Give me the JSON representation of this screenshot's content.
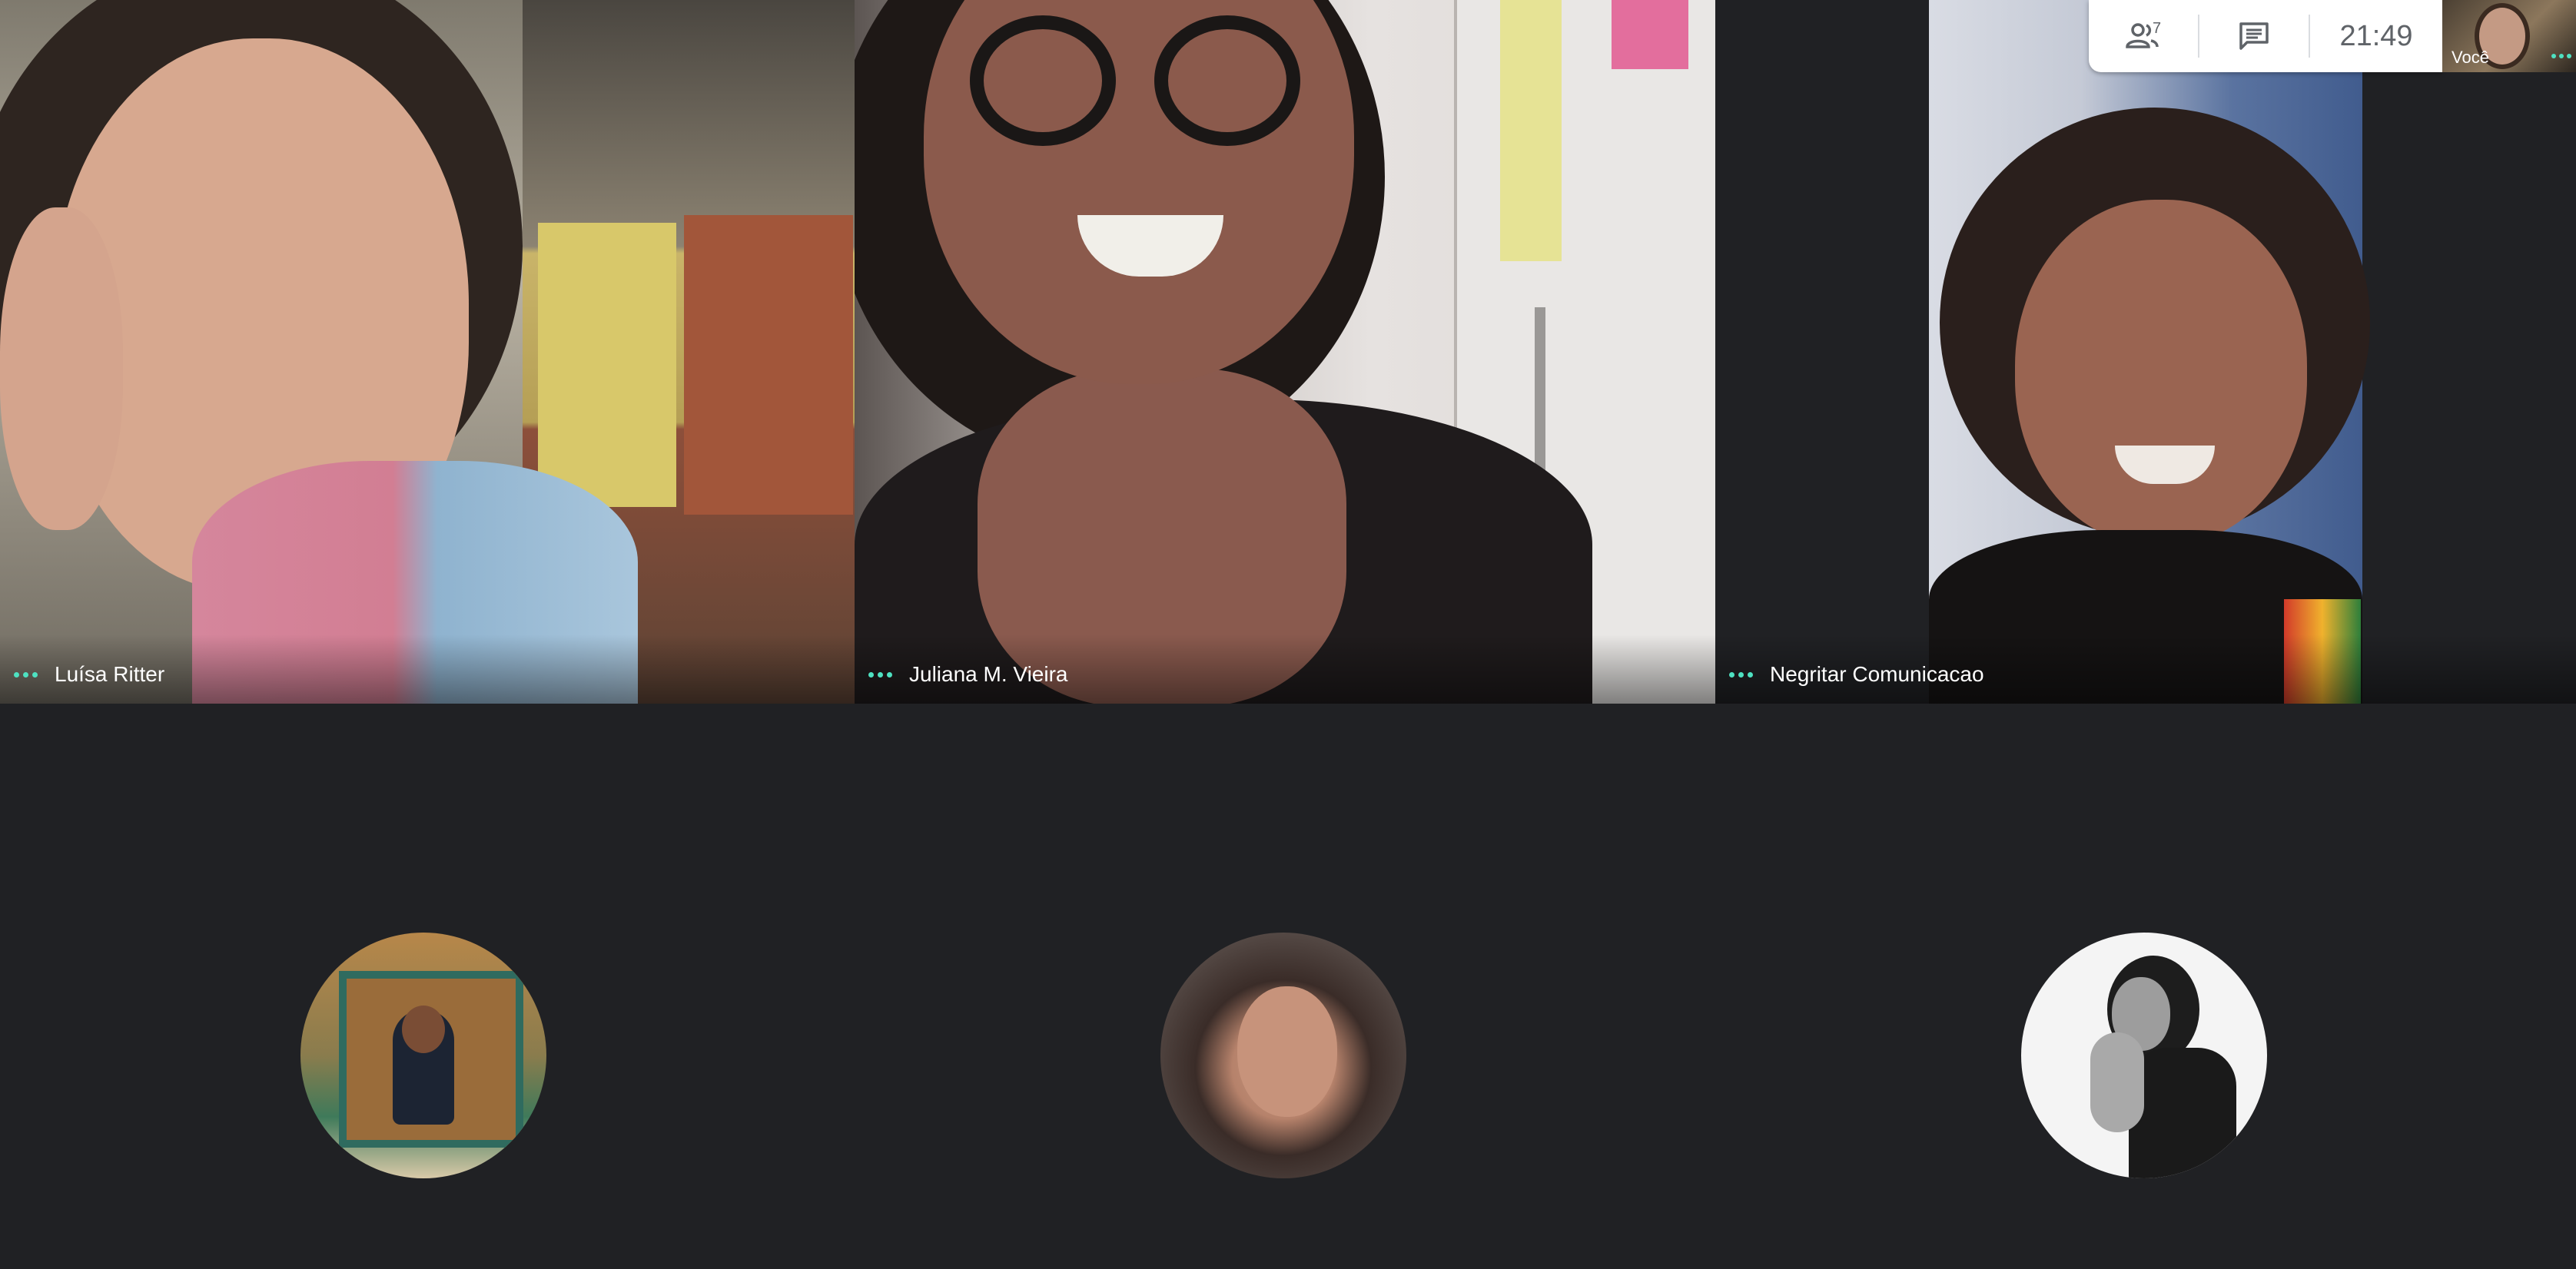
{
  "participants": [
    {
      "name": "Luísa Ritter"
    },
    {
      "name": "Juliana M. Vieira"
    },
    {
      "name": "Negritar Comunicacao"
    }
  ],
  "controls": {
    "participants_count": "7",
    "clock": "21:49",
    "self_label": "Você"
  },
  "icons": {
    "people": "people-icon",
    "chat": "chat-icon",
    "audio_indicator": "audio-dots-icon"
  },
  "colors": {
    "background": "#202124",
    "audio_indicator": "#4ee1c1"
  }
}
